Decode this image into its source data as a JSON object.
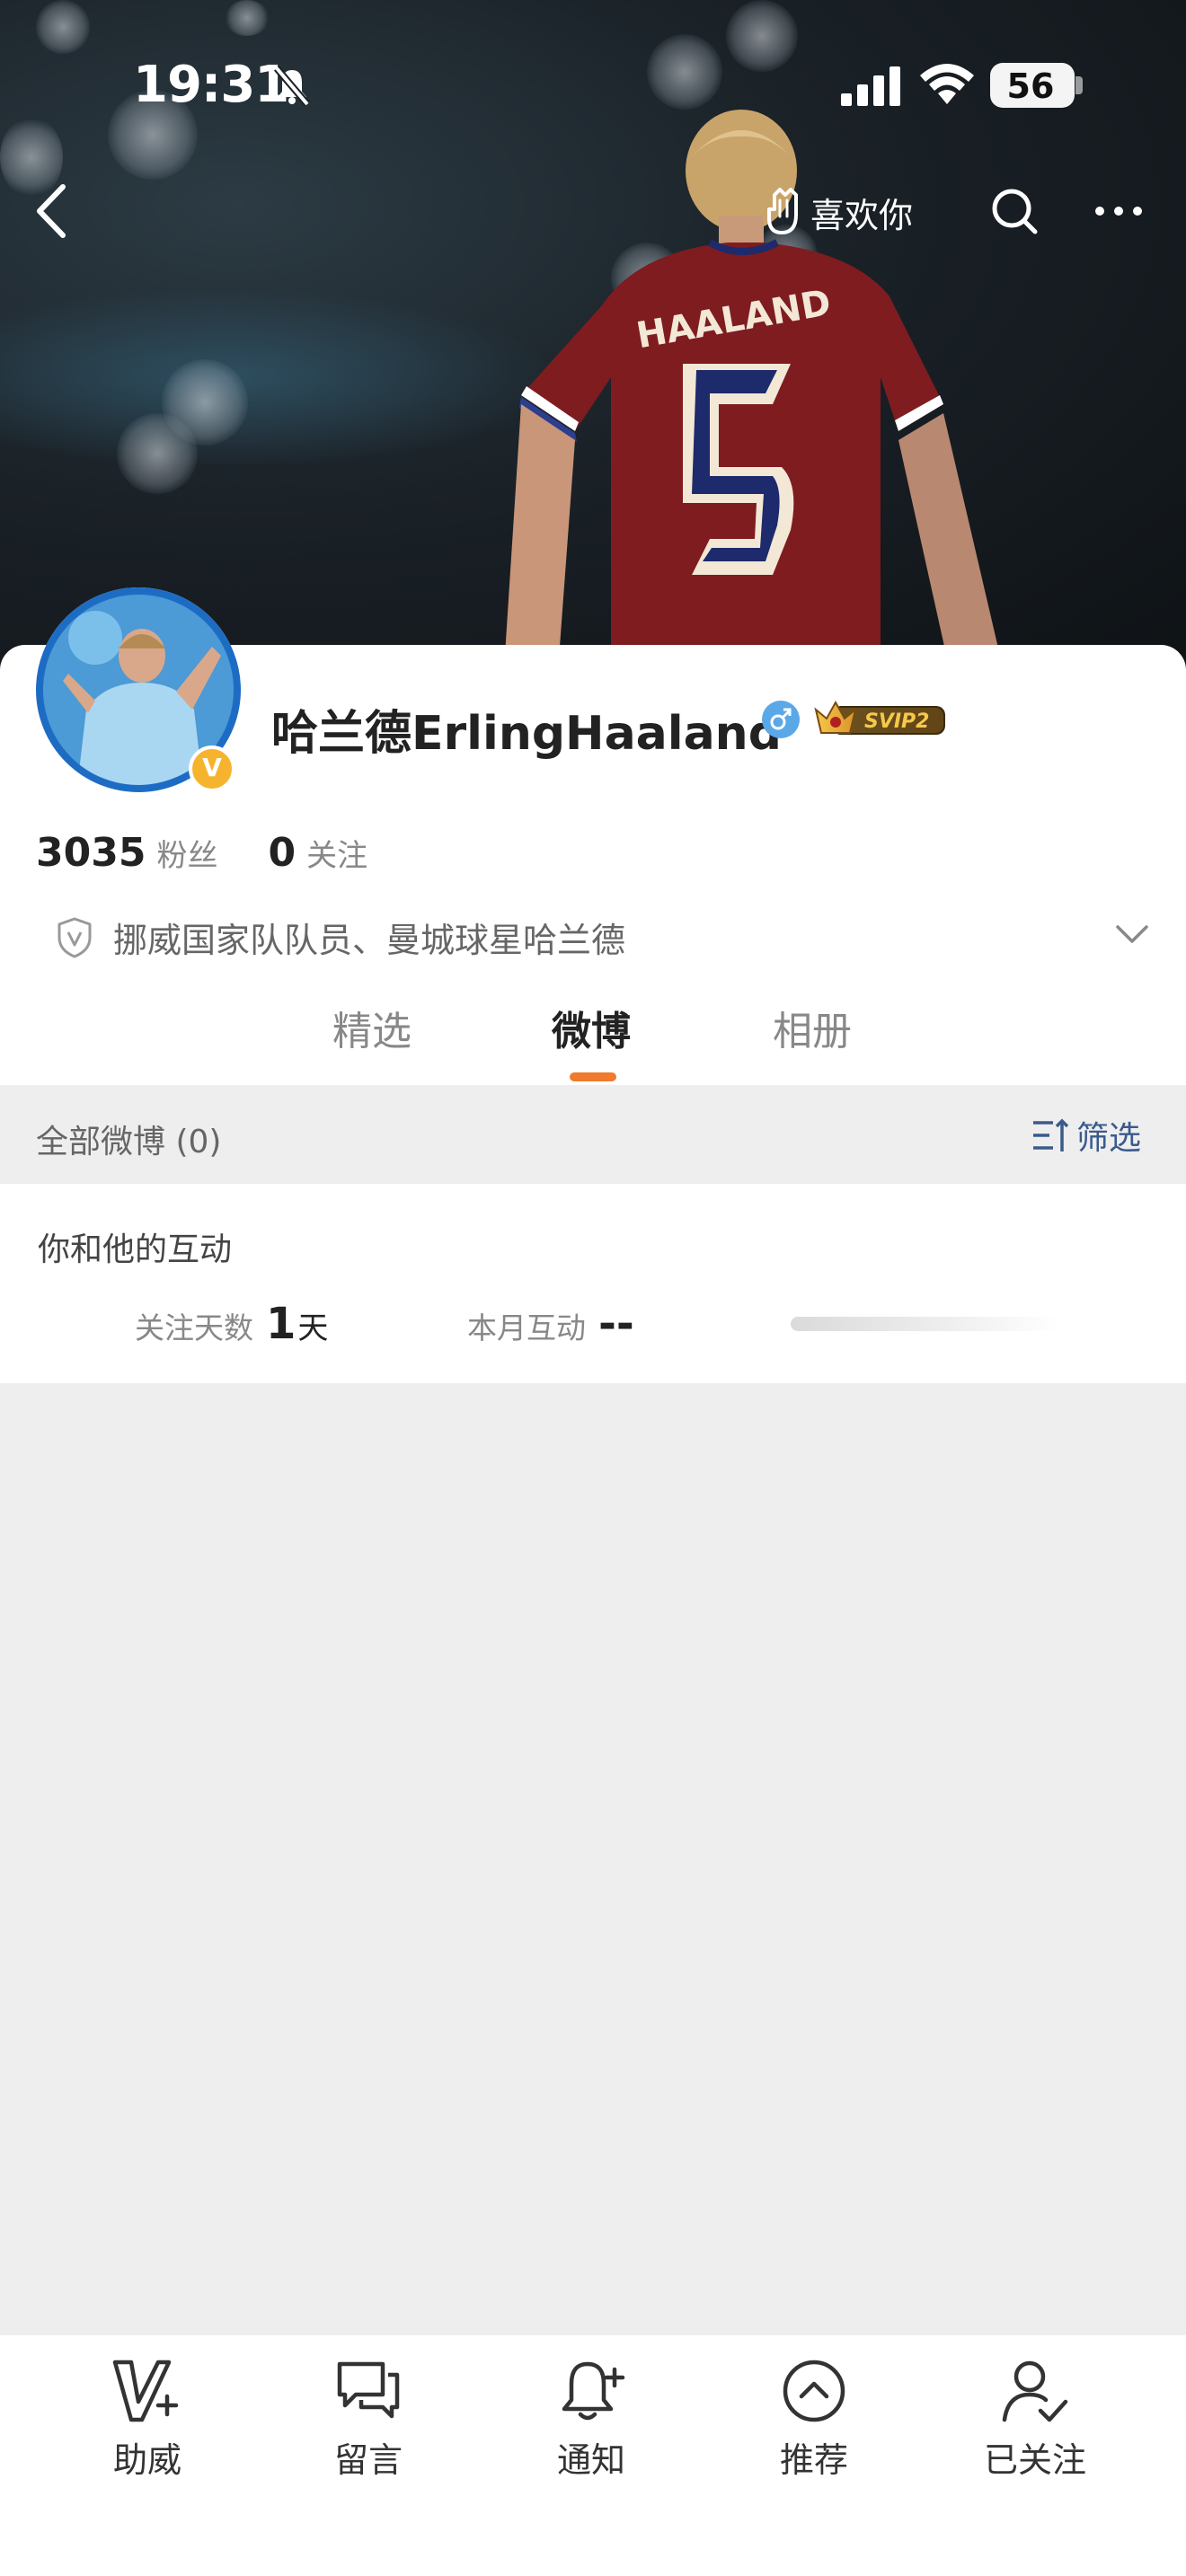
{
  "status_bar": {
    "time": "19:31",
    "battery": "56"
  },
  "nav": {
    "like_label": "喜欢你"
  },
  "profile": {
    "name": "哈兰德ErlingHaaland",
    "avatar_badge": "V",
    "svip": "SVIP2",
    "followers_count": "3035",
    "followers_label": "粉丝",
    "following_count": "0",
    "following_label": "关注",
    "verification": "挪威国家队队员、曼城球星哈兰德"
  },
  "tabs": [
    {
      "label": "精选",
      "active": false
    },
    {
      "label": "微博",
      "active": true
    },
    {
      "label": "相册",
      "active": false
    }
  ],
  "feed": {
    "title": "全部微博 (0)",
    "filter_label": "筛选"
  },
  "interaction": {
    "title": "你和他的互动",
    "follow_days_label": "关注天数",
    "follow_days_value": "1",
    "follow_days_unit": "天",
    "monthly_label": "本月互动",
    "monthly_value": "--"
  },
  "toolbar": [
    {
      "label": "助威",
      "icon": "cheer-icon"
    },
    {
      "label": "留言",
      "icon": "message-icon"
    },
    {
      "label": "通知",
      "icon": "bell-plus-icon"
    },
    {
      "label": "推荐",
      "icon": "recommend-icon"
    },
    {
      "label": "已关注",
      "icon": "followed-user-icon"
    }
  ],
  "colors": {
    "accent": "#f07a2d",
    "link": "#3b5a8c",
    "vip_gold": "#f6b42e"
  }
}
